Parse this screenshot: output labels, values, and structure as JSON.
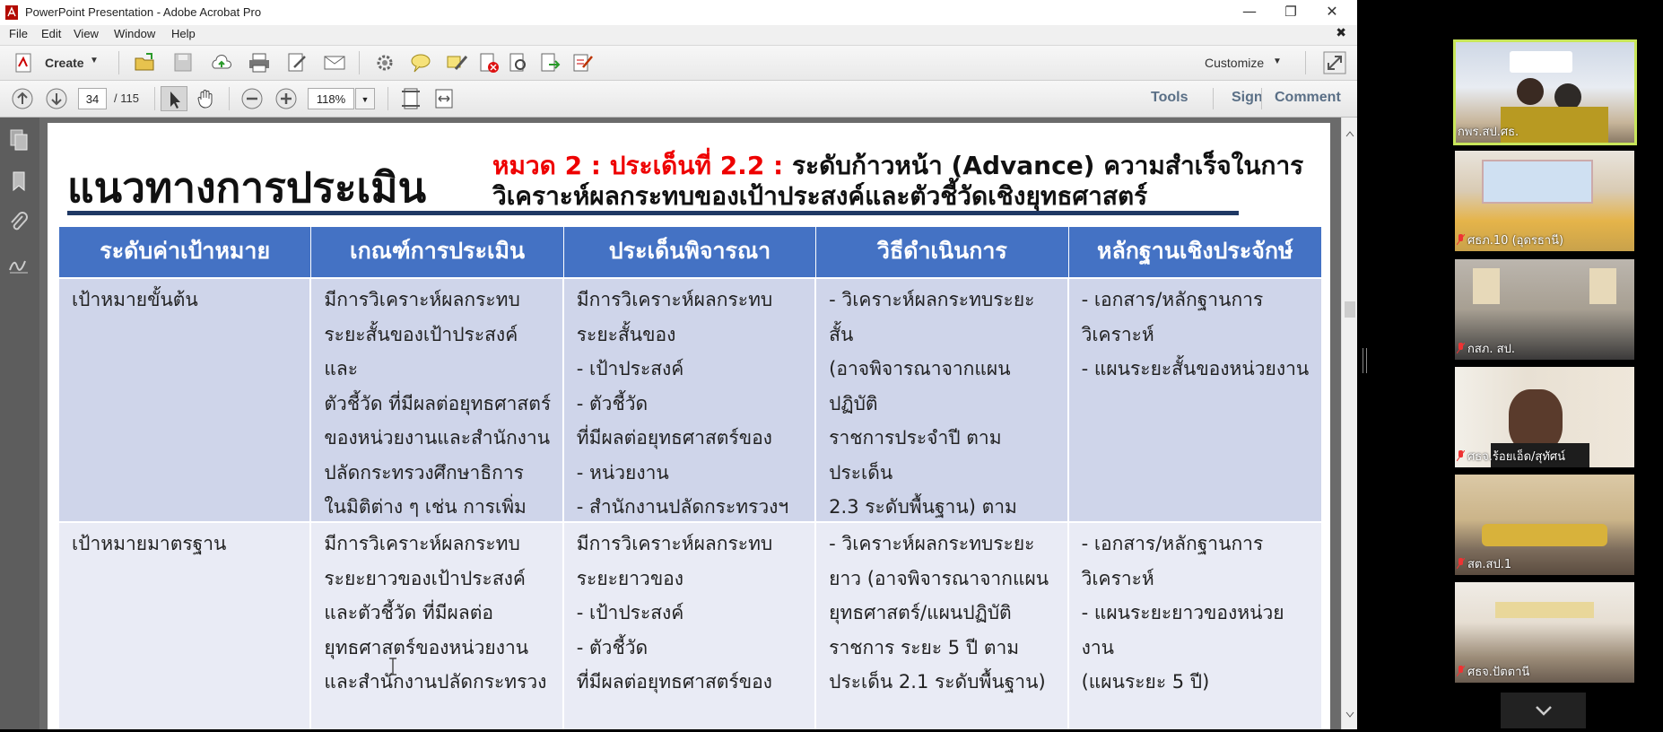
{
  "window": {
    "title": "PowerPoint Presentation - Adobe Acrobat Pro",
    "minimize": "—",
    "restore": "❐",
    "close": "✕"
  },
  "menu": {
    "items": [
      "File",
      "Edit",
      "View",
      "Window",
      "Help"
    ],
    "close_doc": "✖"
  },
  "toolbar": {
    "create_label": "Create",
    "customize_label": "Customize"
  },
  "nav": {
    "page_current": "34",
    "page_total": "/ 115",
    "zoom": "118%"
  },
  "right_links": {
    "tools": "Tools",
    "sign": "Sign",
    "comment": "Comment"
  },
  "slide": {
    "title": "แนวทางการประเมิน",
    "subtitle_red": "หมวด 2 : ประเด็นที่ 2.2 :",
    "subtitle_black": " ระดับก้าวหน้า (Advance)  ความสำเร็จในการ",
    "subtitle_line2": "วิเคราะห์ผลกระทบของเป้าประสงค์และตัวชี้วัดเชิงยุทธศาสตร์",
    "headers": [
      "ระดับค่าเป้าหมาย",
      "เกณฑ์การประเมิน",
      "ประเด็นพิจารณา",
      "วิธีดำเนินการ",
      "หลักฐานเชิงประจักษ์"
    ],
    "rows": [
      [
        "เป้าหมายขั้นต้น",
        "มีการวิเคราะห์ผลกระทบ\nระยะสั้นของเป้าประสงค์และ\nตัวชี้วัด ที่มีผลต่อยุทธศาสตร์\nของหน่วยงานและสำนักงาน\nปลัดกระทรวงศึกษาธิการ\nในมิติต่าง ๆ เช่น การเพิ่มขีด\nความสามารถในการแข่งขัน",
        "มีการวิเคราะห์ผลกระทบ\nระยะสั้นของ\n- เป้าประสงค์\n- ตัวชี้วัด\nที่มีผลต่อยุทธศาสตร์ของ\n- หน่วยงาน\n- สำนักงานปลัดกระทรวงฯ\nในมิติต่าง ๆ",
        "- วิเคราะห์ผลกระทบระยะสั้น\n(อาจพิจารณาจากแผนปฏิบัติ\nราชการประจำปี ตามประเด็น\n2.3 ระดับพื้นฐาน) ตาม\nประเด็นพิจารณา",
        "- เอกสาร/หลักฐานการ\nวิเคราะห์\n- แผนระยะสั้นของหน่วยงาน"
      ],
      [
        "เป้าหมายมาตรฐาน",
        "มีการวิเคราะห์ผลกระทบ\nระยะยาวของเป้าประสงค์\nและตัวชี้วัด ที่มีผลต่อ\nยุทธศาสตร์ของหน่วยงาน\nและสำนักงานปลัดกระทรวง",
        "มีการวิเคราะห์ผลกระทบ\nระยะยาวของ\n- เป้าประสงค์\n- ตัวชี้วัด\nที่มีผลต่อยุทธศาสตร์ของ",
        "- วิเคราะห์ผลกระทบระยะ\nยาว (อาจพิจารณาจากแผน\nยุทธศาสตร์/แผนปฏิบัติ\nราชการ ระยะ 5 ปี ตาม\nประเด็น 2.1 ระดับพื้นฐาน)",
        "- เอกสาร/หลักฐานการ\nวิเคราะห์\n- แผนระยะยาวของหน่วยงาน\n  (แผนระยะ 5 ปี)"
      ]
    ]
  },
  "participants": [
    {
      "name": "กพร.สป.ศธ."
    },
    {
      "name": "ศธภ.10 (อุดรธานี)"
    },
    {
      "name": "กสภ. สป."
    },
    {
      "name": "ศธจ.ร้อยเอ็ด/สุทัศน์"
    },
    {
      "name": "สต.สป.1"
    },
    {
      "name": "ศธจ.ปัตตานี"
    }
  ],
  "scroll_down_icon": "chevron-down-icon"
}
